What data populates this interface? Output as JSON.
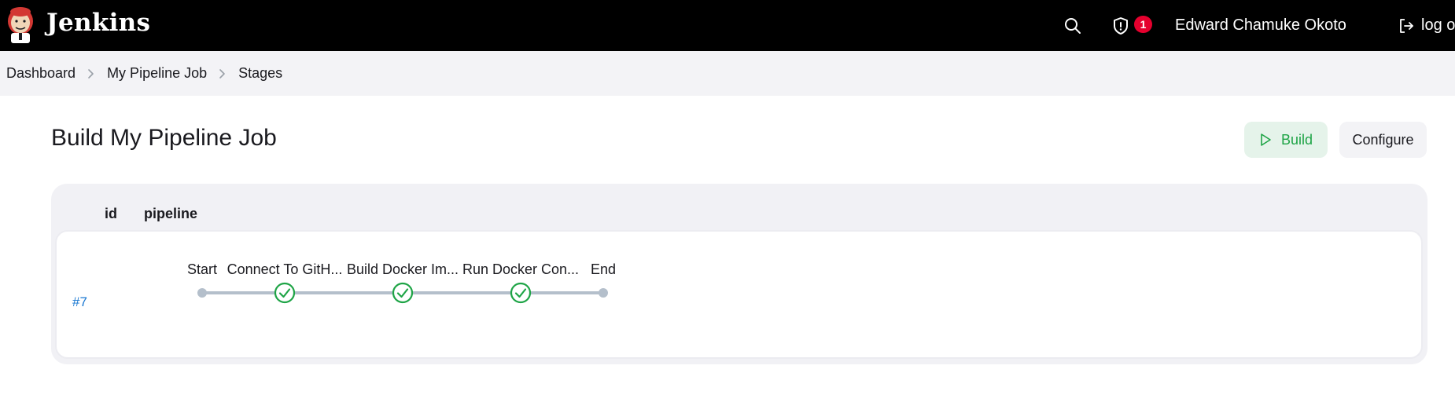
{
  "header": {
    "brand": "Jenkins",
    "search_icon": "search-icon",
    "security_badge_count": "1",
    "user_name": "Edward Chamuke Okoto",
    "logout_label": "log o"
  },
  "breadcrumb": [
    "Dashboard",
    "My Pipeline Job",
    "Stages"
  ],
  "page": {
    "title": "Build My Pipeline Job",
    "build_label": "Build",
    "configure_label": "Configure"
  },
  "table": {
    "col_id": "id",
    "col_pipeline": "pipeline",
    "run": {
      "id": "#7",
      "stages": [
        {
          "name": "Start",
          "status": "node"
        },
        {
          "name": "Connect To GitH...",
          "status": "success"
        },
        {
          "name": "Build Docker Im...",
          "status": "success"
        },
        {
          "name": "Run Docker Con...",
          "status": "success"
        },
        {
          "name": "End",
          "status": "node"
        }
      ]
    }
  },
  "colors": {
    "header_bg": "#000000",
    "success": "#1ea446",
    "link": "#1a78d2",
    "badge": "#e5002e",
    "line": "#b4bfcb"
  }
}
